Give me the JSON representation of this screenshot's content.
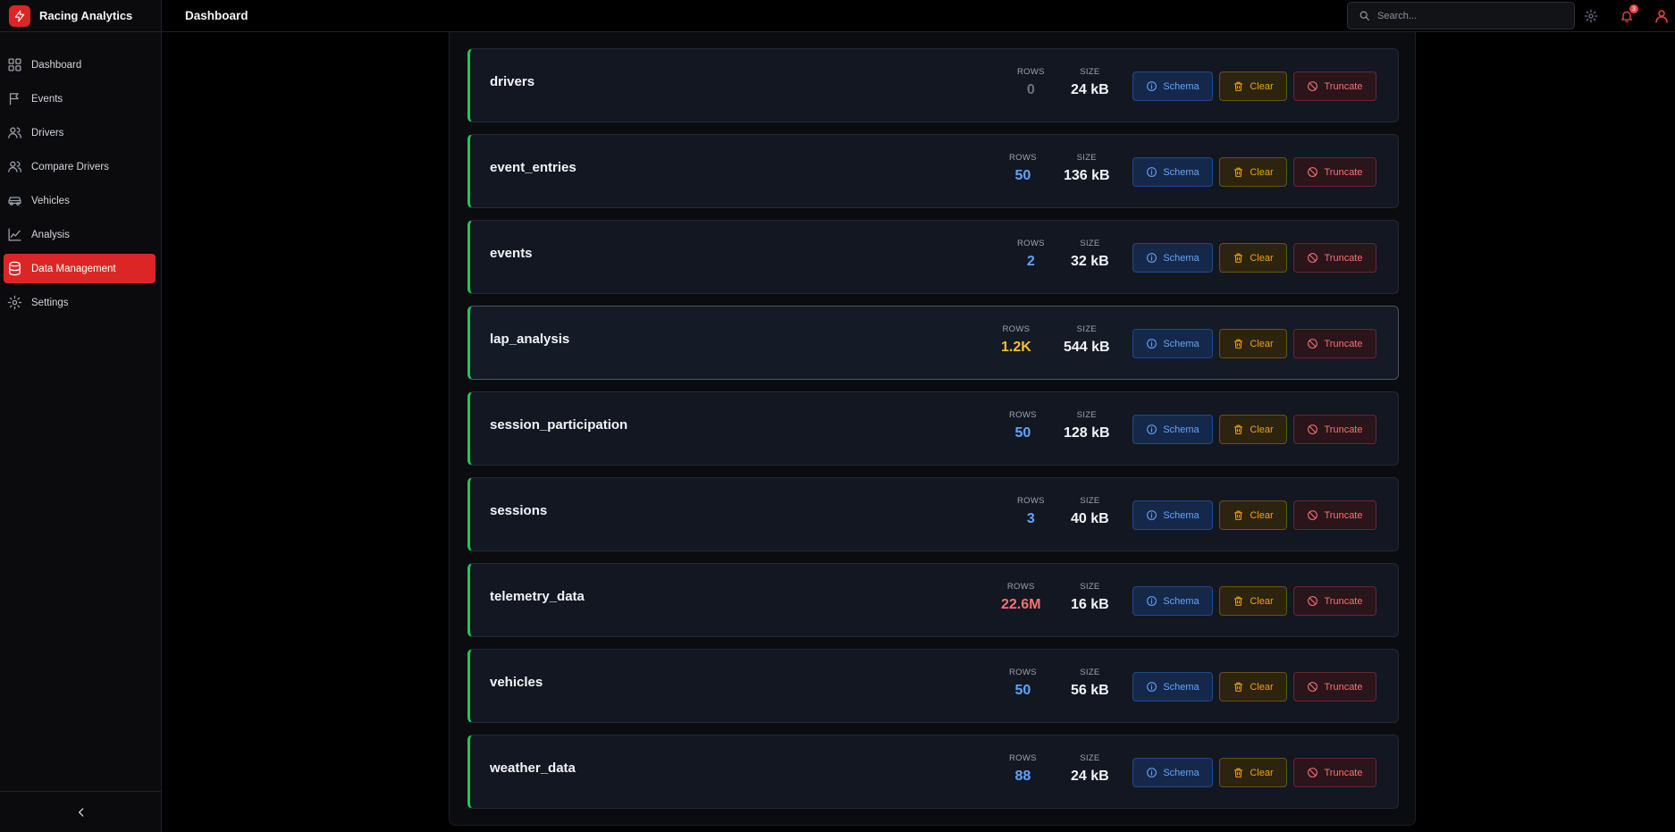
{
  "app": {
    "name": "Racing Analytics"
  },
  "header": {
    "title": "Dashboard",
    "search_placeholder": "Search...",
    "notification_count": "3"
  },
  "sidebar": {
    "items": [
      {
        "label": "Dashboard",
        "icon": "grid-icon",
        "active": false
      },
      {
        "label": "Events",
        "icon": "flag-icon",
        "active": false
      },
      {
        "label": "Drivers",
        "icon": "users-icon",
        "active": false
      },
      {
        "label": "Compare Drivers",
        "icon": "users-icon",
        "active": false
      },
      {
        "label": "Vehicles",
        "icon": "car-icon",
        "active": false
      },
      {
        "label": "Analysis",
        "icon": "chart-line-icon",
        "active": false
      },
      {
        "label": "Data Management",
        "icon": "database-icon",
        "active": true
      },
      {
        "label": "Settings",
        "icon": "gear-icon",
        "active": false
      }
    ]
  },
  "labels": {
    "rows": "ROWS",
    "size": "SIZE",
    "schema": "Schema",
    "clear": "Clear",
    "truncate": "Truncate"
  },
  "colors": {
    "accent": "#dc2626",
    "blue": "#60a5fa",
    "amber": "#f59e0b",
    "red": "#f87171",
    "muted": "#6b7280",
    "green": "#22c55e"
  },
  "tables": [
    {
      "name": "drivers",
      "rows": "0",
      "size": "24 kB",
      "rows_color": "#6b7280"
    },
    {
      "name": "event_entries",
      "rows": "50",
      "size": "136 kB",
      "rows_color": "#60a5fa"
    },
    {
      "name": "events",
      "rows": "2",
      "size": "32 kB",
      "rows_color": "#60a5fa"
    },
    {
      "name": "lap_analysis",
      "rows": "1.2K",
      "size": "544 kB",
      "rows_color": "#fbbf24"
    },
    {
      "name": "session_participation",
      "rows": "50",
      "size": "128 kB",
      "rows_color": "#60a5fa"
    },
    {
      "name": "sessions",
      "rows": "3",
      "size": "40 kB",
      "rows_color": "#60a5fa"
    },
    {
      "name": "telemetry_data",
      "rows": "22.6M",
      "size": "16 kB",
      "rows_color": "#f87171"
    },
    {
      "name": "vehicles",
      "rows": "50",
      "size": "56 kB",
      "rows_color": "#60a5fa"
    },
    {
      "name": "weather_data",
      "rows": "88",
      "size": "24 kB",
      "rows_color": "#60a5fa"
    }
  ]
}
